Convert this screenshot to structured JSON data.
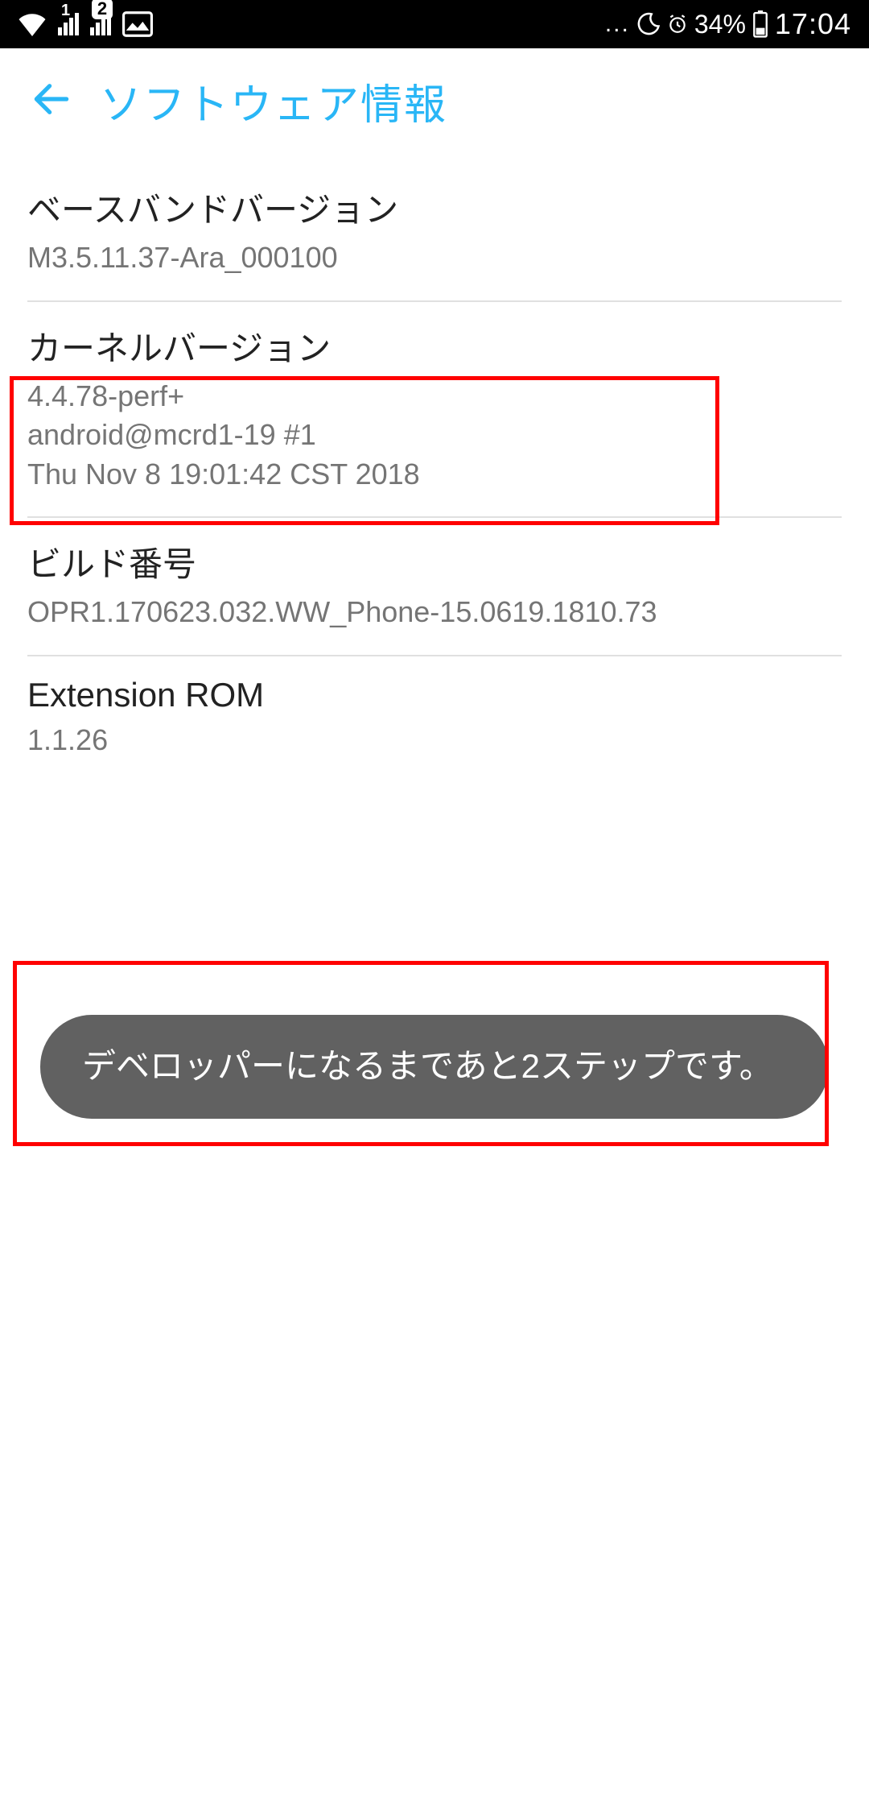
{
  "status_bar": {
    "signal_label_1": "1",
    "signal_label_2": "2",
    "battery_pct": "34%",
    "time": "17:04",
    "ellipsis": "..."
  },
  "header": {
    "title": "ソフトウェア情報"
  },
  "items": [
    {
      "label": "ベースバンドバージョン",
      "value": "M3.5.11.37-Ara_000100"
    },
    {
      "label": "カーネルバージョン",
      "lines": [
        "4.4.78-perf+",
        "android@mcrd1-19 #1",
        "Thu Nov 8 19:01:42 CST 2018"
      ]
    },
    {
      "label": "ビルド番号",
      "value": "OPR1.170623.032.WW_Phone-15.0619.1810.73"
    },
    {
      "label": "Extension ROM",
      "value": "1.1.26"
    }
  ],
  "toast": {
    "message": "デベロッパーになるまであと2ステップです。"
  }
}
